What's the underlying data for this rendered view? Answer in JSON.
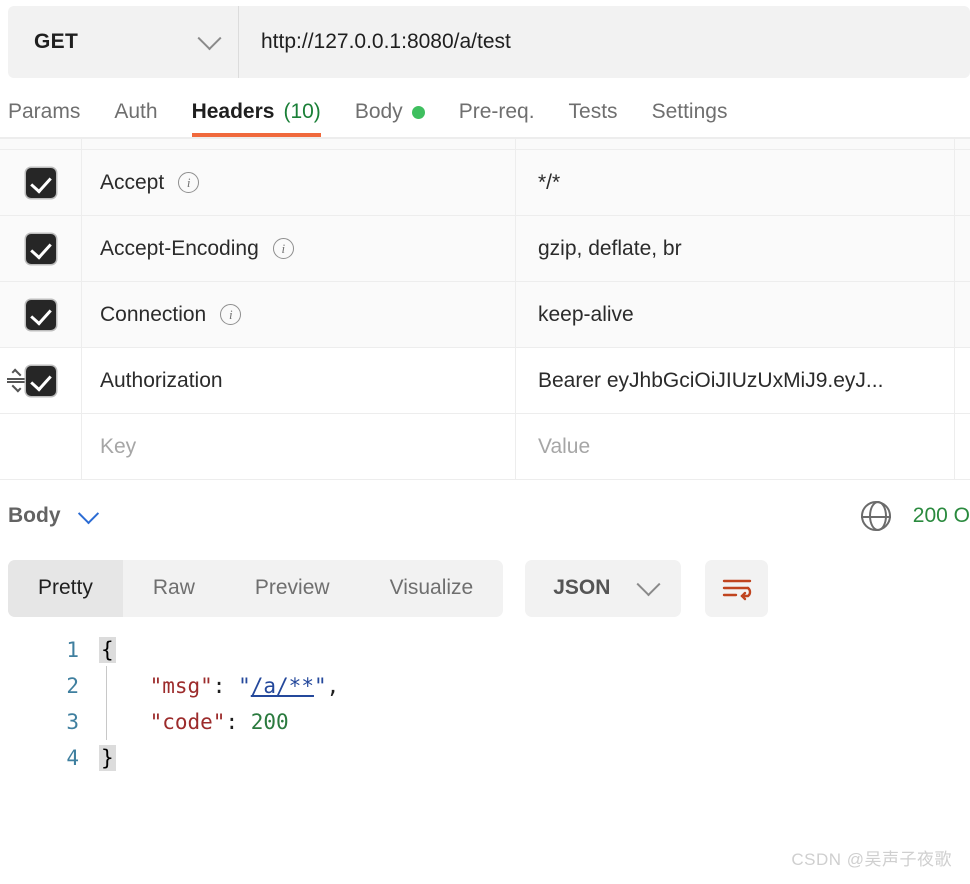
{
  "request": {
    "method": "GET",
    "method_dropdown_icon": "chevron-down-icon",
    "url": "http://127.0.0.1:8080/a/test"
  },
  "tabs": [
    {
      "label": "Params",
      "active": false,
      "count": "",
      "dot": false
    },
    {
      "label": "Auth",
      "active": false,
      "count": "",
      "dot": false
    },
    {
      "label": "Headers",
      "active": true,
      "count": "(10)",
      "dot": false
    },
    {
      "label": "Body",
      "active": false,
      "count": "",
      "dot": true
    },
    {
      "label": "Pre-req.",
      "active": false,
      "count": "",
      "dot": false
    },
    {
      "label": "Tests",
      "active": false,
      "count": "",
      "dot": false
    },
    {
      "label": "Settings",
      "active": false,
      "count": "",
      "dot": false
    }
  ],
  "headers_table": {
    "rows": [
      {
        "checked": true,
        "key": "Accept",
        "value": "*/*",
        "info": true,
        "drag": false,
        "hover": false
      },
      {
        "checked": true,
        "key": "Accept-Encoding",
        "value": "gzip, deflate, br",
        "info": true,
        "drag": false,
        "hover": false
      },
      {
        "checked": true,
        "key": "Connection",
        "value": "keep-alive",
        "info": true,
        "drag": false,
        "hover": false
      },
      {
        "checked": true,
        "key": "Authorization",
        "value": "Bearer eyJhbGciOiJIUzUxMiJ9.eyJ...",
        "info": false,
        "drag": true,
        "hover": true
      }
    ],
    "new_row": {
      "key_placeholder": "Key",
      "value_placeholder": "Value"
    }
  },
  "response": {
    "body_label": "Body",
    "collapse_icon": "chevron-down-icon",
    "network_icon": "globe-icon",
    "status": "200 O",
    "status_color": "#2a8a3e",
    "view_tabs": [
      {
        "label": "Pretty",
        "active": true
      },
      {
        "label": "Raw",
        "active": false
      },
      {
        "label": "Preview",
        "active": false
      },
      {
        "label": "Visualize",
        "active": false
      }
    ],
    "format": "JSON",
    "format_dropdown_icon": "chevron-down-icon",
    "wrap_icon": "wrap-lines-icon",
    "wrap_icon_color": "#c0441f",
    "code": {
      "line_numbers": [
        "1",
        "2",
        "3",
        "4"
      ],
      "raw": "{\n    \"msg\": \"/a/**\",\n    \"code\": 200\n}",
      "tokens": {
        "open_brace": "{",
        "close_brace": "}",
        "key_msg": "\"msg\"",
        "val_msg": "/a/**",
        "key_code": "\"code\"",
        "val_code": "200",
        "colon": ": ",
        "comma": ",",
        "quote": "\"",
        "indent": "    "
      }
    }
  },
  "accent": {
    "tab_underline": "#f0693c",
    "count_green": "#1a7f37",
    "body_dot_green": "#3fbf5f"
  },
  "watermark": "CSDN @吴声子夜歌"
}
